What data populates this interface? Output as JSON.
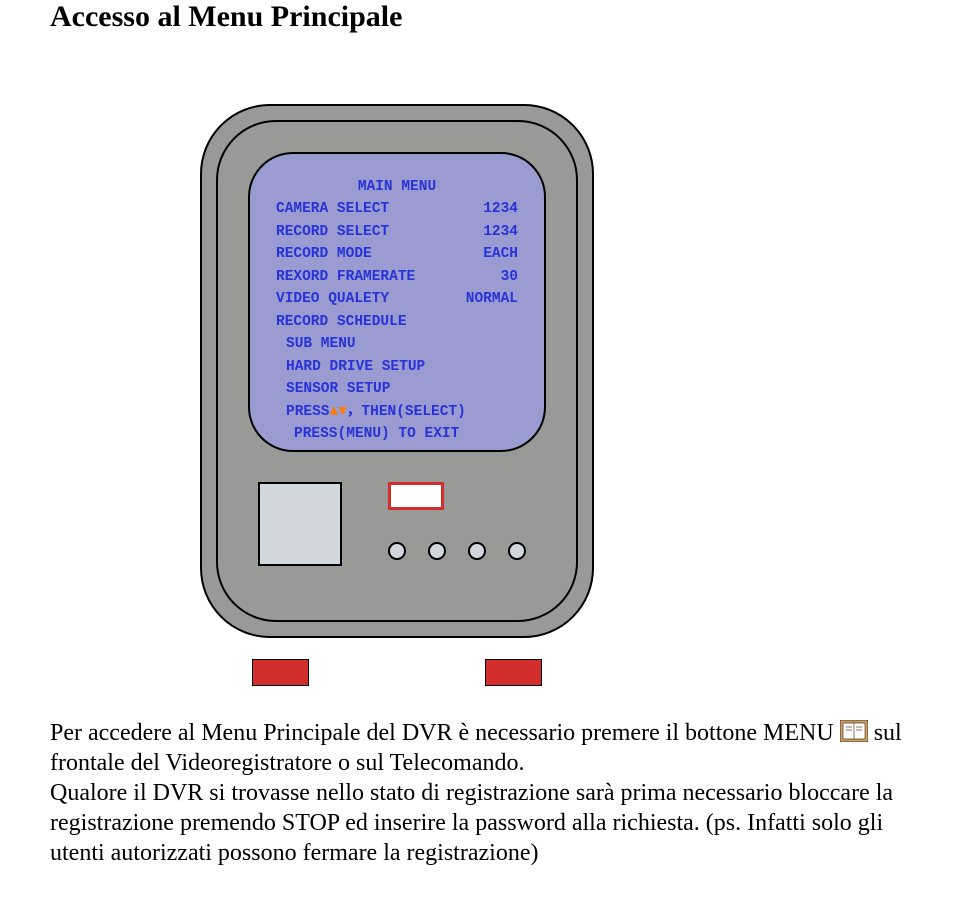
{
  "title": "Accesso al Menu Principale",
  "screen": {
    "heading": "MAIN MENU",
    "rows": [
      {
        "label": "CAMERA SELECT",
        "value": "1234"
      },
      {
        "label": "RECORD SELECT",
        "value": "1234"
      },
      {
        "label": "RECORD MODE",
        "value": "EACH"
      },
      {
        "label": "REXORD FRAMERATE",
        "value": "30"
      },
      {
        "label": "VIDEO QUALETY",
        "value": "NORMAL"
      },
      {
        "label": "RECORD SCHEDULE",
        "value": ""
      }
    ],
    "sub1": "SUB MENU",
    "sub2": "HARD DRIVE SETUP",
    "sub3": "SENSOR SETUP",
    "press_label": "PRESS",
    "then_select": "，THEN(SELECT)",
    "exit": "PRESS(MENU)  TO  EXIT"
  },
  "paragraph": {
    "p1a": "Per accedere al Menu Principale del DVR è necessario premere il bottone MENU ",
    "p1b": " sul frontale del Videoregistratore o sul Telecomando.",
    "p2": "Qualore il DVR si trovasse nello stato di registrazione sarà prima necessario bloccare la registrazione premendo STOP ed inserire la password alla richiesta. (ps. Infatti solo gli utenti autorizzati possono fermare la registrazione)"
  }
}
